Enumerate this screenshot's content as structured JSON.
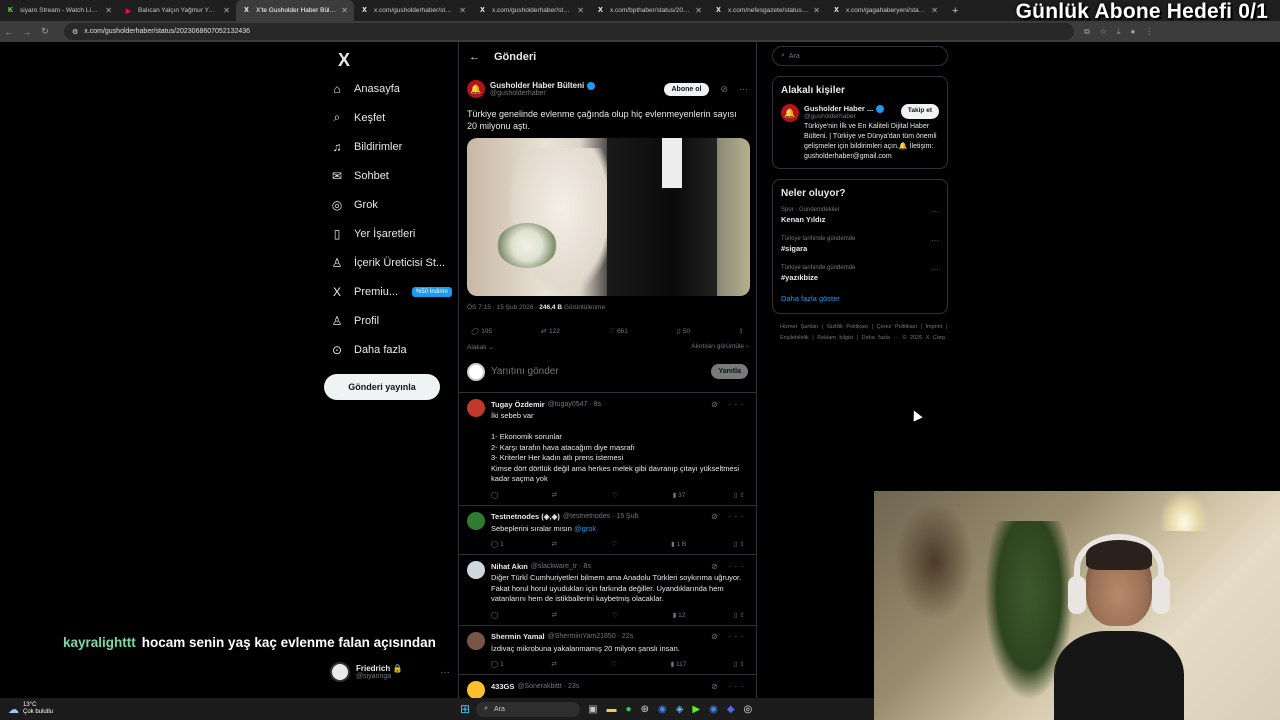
{
  "browser": {
    "tabs": [
      {
        "title": "siyaro Stream - Watch Live on Kick",
        "fav": "K",
        "color": "#53fc18"
      },
      {
        "title": "Balıcan Yalçın Yağmur Yağar Bana",
        "fav": "▶",
        "color": "#ff0033"
      },
      {
        "title": "X'te Gusholder Haber Bülteni: \"Türkiye",
        "fav": "X",
        "color": "#ffffff"
      },
      {
        "title": "x.com/gusholderhaber/status/2023068",
        "fav": "X",
        "color": "#ffffff"
      },
      {
        "title": "x.com/gusholderhaber/status/20230",
        "fav": "X",
        "color": "#ffffff"
      },
      {
        "title": "x.com/bpthaber/status/20230",
        "fav": "X",
        "color": "#ffffff"
      },
      {
        "title": "x.com/nefesgazete/status/2023",
        "fav": "X",
        "color": "#ffffff"
      },
      {
        "title": "x.com/gagahaberyeni/status/20",
        "fav": "X",
        "color": "#ffffff"
      }
    ],
    "url": "x.com/gusholderhaber/status/2023068607052132436"
  },
  "overlay": {
    "goal_text": "Günlük Abone Hedefi 0/1"
  },
  "nav": {
    "items": [
      {
        "label": "Anasayfa",
        "icon": "⌂"
      },
      {
        "label": "Keşfet",
        "icon": "⌕"
      },
      {
        "label": "Bildirimler",
        "icon": "♫"
      },
      {
        "label": "Sohbet",
        "icon": "✉"
      },
      {
        "label": "Grok",
        "icon": "◎"
      },
      {
        "label": "Yer İşaretleri",
        "icon": "▯"
      },
      {
        "label": "İçerik Üreticisi St...",
        "icon": "♙"
      },
      {
        "label": "Premiu...",
        "icon": "X"
      },
      {
        "label": "Profil",
        "icon": "♙"
      },
      {
        "label": "Daha fazla",
        "icon": "⊙"
      }
    ],
    "promo_badge": "%50 İndirim",
    "post_button": "Gönderi yayınla",
    "user": {
      "name": "Friedrich 🔒",
      "handle": "@siyaringa"
    }
  },
  "chat": {
    "user": "kayralighttt",
    "message": "hocam senin yaş kaç evlenme falan açısından"
  },
  "main": {
    "header": "Gönderi",
    "post": {
      "author": "Gusholder Haber Bülteni",
      "handle": "@gusholderhaber",
      "follow_label": "Abone ol",
      "text": "Türkiye genelinde evlenme çağında olup hiç evlenmeyenlerin sayısı 20 milyonu aştı.",
      "time": "ÖS 7:15 · 15 Şub 2026 · ",
      "views": "246,4 B",
      "views_label": " Görüntülenme",
      "replies": "195",
      "reposts": "122",
      "likes": "661",
      "bookmarks": "50",
      "relevant": "Alakalı ⌄",
      "quotes": "Alıntıları görüntüle ›"
    },
    "reply_placeholder": "Yanıtını gönder",
    "reply_button": "Yanıtla",
    "comments": [
      {
        "name": "Tugay Özdemir",
        "handle": "@tugay0547 · 8s",
        "text": "İki sebeb var\n\n1- Ekonomik sorunlar\n2- Karşı tarafın hava atacağım diye masrafı\n3- Kriterler Her kadın atlı prens istemesi\nKimse dört dörtlük değil ama herkes melek gibi davranıp çıtayı yükseltmesi kadar saçma yok",
        "replies": "",
        "reposts": "",
        "likes": "",
        "views": "37",
        "avatar": "#c0392b"
      },
      {
        "name": "Testnetnodes (◈,◈)",
        "handle": "@testnetnodes · 15 Şub",
        "text": "Sebeplerini sıralar mısın ",
        "link": "@grok",
        "replies": "1",
        "reposts": "",
        "likes": "",
        "views": "1 B",
        "avatar": "#2e7d32"
      },
      {
        "name": "Nihat Akın",
        "handle": "@slackware_tr · 8s",
        "text": "Diğer Türkî Cumhuriyetleri bilmem ama Anadolu Türkleri soykırıma uğruyor. Fakat horul horul uyudukları için farkında değiller. Uyandıklarında hem vatanlarını hem de istikballerini kaybetmiş olacaklar.",
        "replies": "",
        "reposts": "",
        "likes": "",
        "views": "12",
        "avatar": "#cfd8dc"
      },
      {
        "name": "Shermin Yamal",
        "handle": "@ShermiinYam21850 · 22s",
        "text": "İzdivaç mikrobuna yakalanmamış 20 milyon şanslı insan.",
        "replies": "1",
        "reposts": "",
        "likes": "",
        "views": "117",
        "avatar": "#795548"
      },
      {
        "name": "433GS",
        "handle": "@Sonerakbittt · 23s",
        "text": "",
        "replies": "",
        "reposts": "",
        "likes": "",
        "views": "",
        "avatar": "#fbc02d"
      }
    ]
  },
  "right": {
    "search_placeholder": "Ara",
    "relevant_title": "Alakalı kişiler",
    "person": {
      "name": "Gusholder Haber ...",
      "handle": "@gusholderhaber",
      "follow_label": "Takip et",
      "bio": "Türkiye'nin İlk ve En Kaliteli Dijital Haber Bülteni. | Türkiye ve Dünya'dan tüm önemli gelişmeler için bildirimleri açın.🔔 İletişim: gusholderhaber@gmail.com"
    },
    "trends_title": "Neler oluyor?",
    "trends": [
      {
        "cat": "Spor · Gündemdekiler",
        "name": "Kenan Yıldız"
      },
      {
        "cat": "Türkiye tarihinde gündemde",
        "name": "#sigara"
      },
      {
        "cat": "Türkiye tarihinde gündemde",
        "name": "#yazıkbize"
      }
    ],
    "show_more": "Daha fazla göster",
    "footer": "Hizmet Şartları | Gizlilik Politikası | Çerez Politikası | Imprint | Erişilebilirlik | Reklam bilgisi | Daha fazla ··· © 2026 X Corp."
  },
  "taskbar": {
    "temp": "13°C",
    "weather": "Çok bulutlu",
    "search": "Ara"
  }
}
